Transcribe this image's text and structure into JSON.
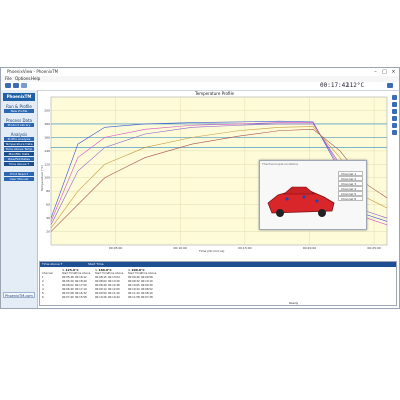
{
  "window": {
    "title": "PhoenixView - PhoenixTM"
  },
  "menu": [
    "File",
    "Options",
    "Help"
  ],
  "toolbar": {
    "clock": "00:17:42",
    "temperature": "112°C"
  },
  "sidebar": {
    "logo": "PhoenixTM",
    "sections": [
      {
        "label": "Run & Profile",
        "buttons": [
          "New Profile"
        ]
      },
      {
        "label": "Process Data",
        "buttons": [
          "Product Library"
        ]
      },
      {
        "label": "Analysis",
        "buttons": [
          "Profile Analysis",
          "Temperature Data",
          "Time Above Temp",
          "Max/Min Data",
          "Rise/Fall Rates",
          "Time Above T"
        ]
      },
      {
        "label": "",
        "buttons": [
          "Print Report",
          "User Manual"
        ]
      }
    ],
    "footer": "PhoenixTM.com"
  },
  "chart": {
    "title": "Temperature Profile",
    "xlabel": "Time (hh:mm:ss)",
    "ylabel": "Temperature (°C)"
  },
  "chart_data": {
    "type": "line",
    "title": "Temperature Profile",
    "xlabel": "Time (hh:mm:ss)",
    "ylabel": "Temperature (°C)",
    "x": [
      0,
      0.08,
      0.16,
      0.28,
      0.42,
      0.56,
      0.68,
      0.78,
      0.86,
      0.94,
      1.0
    ],
    "ylim": [
      0,
      220
    ],
    "yticks": [
      20,
      40,
      60,
      80,
      100,
      120,
      140,
      160,
      180,
      200
    ],
    "xticks": [
      "00:05:00",
      "00:10:00",
      "00:15:00",
      "00:20:00",
      "00:25:00"
    ],
    "reference_lines": [
      180,
      160,
      145
    ],
    "series": [
      {
        "values": [
          40,
          150,
          175,
          180,
          182,
          183,
          184,
          183,
          110,
          45,
          35
        ],
        "color": "#3b55d9"
      },
      {
        "values": [
          35,
          130,
          160,
          172,
          178,
          180,
          182,
          182,
          115,
          40,
          30
        ],
        "color": "#d94ec7"
      },
      {
        "values": [
          30,
          110,
          145,
          165,
          175,
          178,
          180,
          180,
          120,
          50,
          40
        ],
        "color": "#8c5fd0"
      },
      {
        "values": [
          25,
          80,
          120,
          145,
          160,
          170,
          175,
          176,
          130,
          70,
          55
        ],
        "color": "#c79a3b"
      },
      {
        "values": [
          20,
          60,
          100,
          130,
          150,
          162,
          170,
          172,
          140,
          90,
          70
        ],
        "color": "#a84f4f"
      }
    ]
  },
  "popup": {
    "title": "Thermocouple locations",
    "legend": [
      "Channel 1",
      "Channel 2",
      "Channel 3",
      "Channel 4",
      "Channel 5",
      "Channel 6"
    ]
  },
  "table": {
    "tab_labels": [
      "Time Above T",
      "Start Time"
    ],
    "groups": [
      "> 125.0°C",
      "> 180.0°C",
      "> 200.0°C"
    ],
    "columns": [
      "Channel",
      "Start Time",
      "Time Above",
      "Start Time",
      "Time Above",
      "Start Time",
      "Time Above"
    ],
    "rows": [
      [
        "1",
        "00:05:38",
        "00:18:12",
        "00:08:15",
        "00:13:04",
        "00:09:40",
        "00:09:58"
      ],
      [
        "2",
        "00:05:20",
        "00:18:40",
        "00:08:02",
        "00:13:20",
        "00:09:32",
        "00:10:10"
      ],
      [
        "3",
        "00:06:02",
        "00:17:50",
        "00:08:40",
        "00:12:38",
        "00:10:05",
        "00:09:30"
      ],
      [
        "4",
        "00:06:40",
        "00:17:10",
        "00:09:12",
        "00:12:00",
        "00:10:44",
        "00:08:52"
      ],
      [
        "5",
        "00:07:08",
        "00:16:32",
        "00:09:50",
        "00:11:20",
        "00:11:20",
        "00:08:10"
      ],
      [
        "6",
        "00:07:40",
        "00:15:58",
        "00:10:26",
        "00:10:44",
        "00:11:58",
        "00:07:28"
      ]
    ]
  },
  "status": "Ready"
}
